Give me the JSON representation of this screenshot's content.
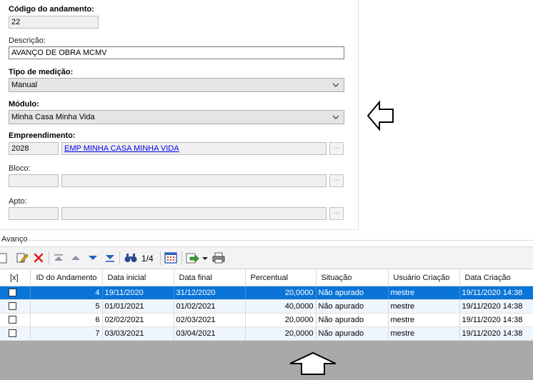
{
  "form": {
    "codigo_label": "Código do andamento:",
    "codigo_value": "22",
    "descricao_label": "Descrição:",
    "descricao_value": "AVANÇO DE OBRA MCMV",
    "tipo_label": "Tipo de medição:",
    "tipo_value": "Manual",
    "modulo_label": "Módulo:",
    "modulo_value": "Minha Casa Minha Vida",
    "empreendimento_label": "Empreendimento:",
    "empreendimento_code": "2028",
    "empreendimento_name": "EMP MINHA CASA MINHA VIDA",
    "bloco_label": "Bloco:",
    "apto_label": "Apto:",
    "ellipsis": "..."
  },
  "avanco": {
    "group_label": "Avanço",
    "pager": "1/4",
    "columns": [
      "[x]",
      "ID do Andamento",
      "Data inicial",
      "Data final",
      "Percentual",
      "Situação",
      "Usuário Criação",
      "Data Criação"
    ],
    "rows": [
      {
        "id": "4",
        "inicio": "19/11/2020",
        "fim": "31/12/2020",
        "perc": "20,0000",
        "sit": "Não apurado",
        "user": "mestre",
        "criacao": "19/11/2020 14:38"
      },
      {
        "id": "5",
        "inicio": "01/01/2021",
        "fim": "01/02/2021",
        "perc": "40,0000",
        "sit": "Não apurado",
        "user": "mestre",
        "criacao": "19/11/2020 14:38"
      },
      {
        "id": "6",
        "inicio": "02/02/2021",
        "fim": "02/03/2021",
        "perc": "20,0000",
        "sit": "Não apurado",
        "user": "mestre",
        "criacao": "19/11/2020 14:38"
      },
      {
        "id": "7",
        "inicio": "03/03/2021",
        "fim": "03/04/2021",
        "perc": "20,0000",
        "sit": "Não apurado",
        "user": "mestre",
        "criacao": "19/11/2020 14:38"
      }
    ]
  },
  "colors": {
    "selection": "#0a74d8",
    "alt_row": "#eef5fc",
    "link": "#0000ee",
    "bottom_gray": "#a9a9a9"
  }
}
